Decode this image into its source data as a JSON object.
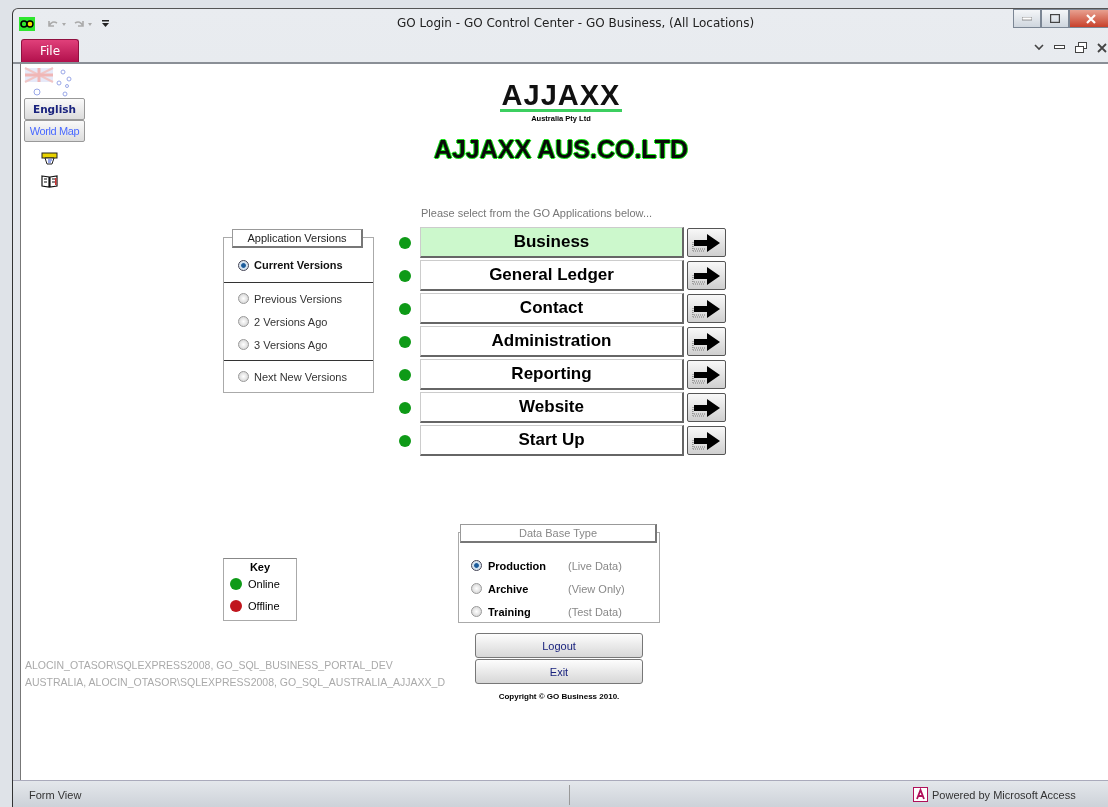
{
  "window": {
    "title": "GO Login  -  GO Control Center - GO Business,   (All Locations)"
  },
  "ribbon": {
    "file_tab": "File"
  },
  "sidebar": {
    "buttons": [
      {
        "label": "English",
        "kind": "bold"
      },
      {
        "label": "World Map",
        "kind": "link"
      }
    ]
  },
  "header": {
    "logo": "AJJAXX",
    "logo_sub": "Australia Pty Ltd",
    "company": "AJJAXX AUS.CO.LTD"
  },
  "prompt": "Please select from the GO Applications below...",
  "versions": {
    "title": "Application Versions",
    "groups": [
      [
        {
          "label": "Current Versions",
          "selected": true
        }
      ],
      [
        {
          "label": "Previous Versions",
          "selected": false
        },
        {
          "label": "2 Versions Ago",
          "selected": false
        },
        {
          "label": "3 Versions Ago",
          "selected": false
        }
      ],
      [
        {
          "label": "Next New Versions",
          "selected": false
        }
      ]
    ]
  },
  "apps": [
    {
      "label": "Business",
      "online": true,
      "selected": true
    },
    {
      "label": "General Ledger",
      "online": true,
      "selected": false
    },
    {
      "label": "Contact",
      "online": true,
      "selected": false
    },
    {
      "label": "Administration",
      "online": true,
      "selected": false
    },
    {
      "label": "Reporting",
      "online": true,
      "selected": false
    },
    {
      "label": "Website",
      "online": true,
      "selected": false
    },
    {
      "label": "Start Up",
      "online": true,
      "selected": false
    }
  ],
  "key": {
    "title": "Key",
    "items": [
      {
        "label": "Online",
        "color": "#0e9a17"
      },
      {
        "label": "Offline",
        "color": "#c0161d"
      }
    ]
  },
  "connections": [
    "ALOCIN_OTASOR\\SQLEXPRESS2008, GO_SQL_BUSINESS_PORTAL_DEV",
    "AUSTRALIA, ALOCIN_OTASOR\\SQLEXPRESS2008, GO_SQL_AUSTRALIA_AJJAXX_D"
  ],
  "database_type": {
    "title": "Data Base Type",
    "options": [
      {
        "label": "Production",
        "note": "(Live Data)",
        "selected": true
      },
      {
        "label": "Archive",
        "note": "(View Only)",
        "selected": false
      },
      {
        "label": "Training",
        "note": "(Test Data)",
        "selected": false
      }
    ]
  },
  "buttons": [
    "Logout",
    "Exit"
  ],
  "copyright": "Copyright © GO Business 2010.",
  "status_bar": {
    "mode": "Form View",
    "powered": "Powered by Microsoft Access"
  }
}
